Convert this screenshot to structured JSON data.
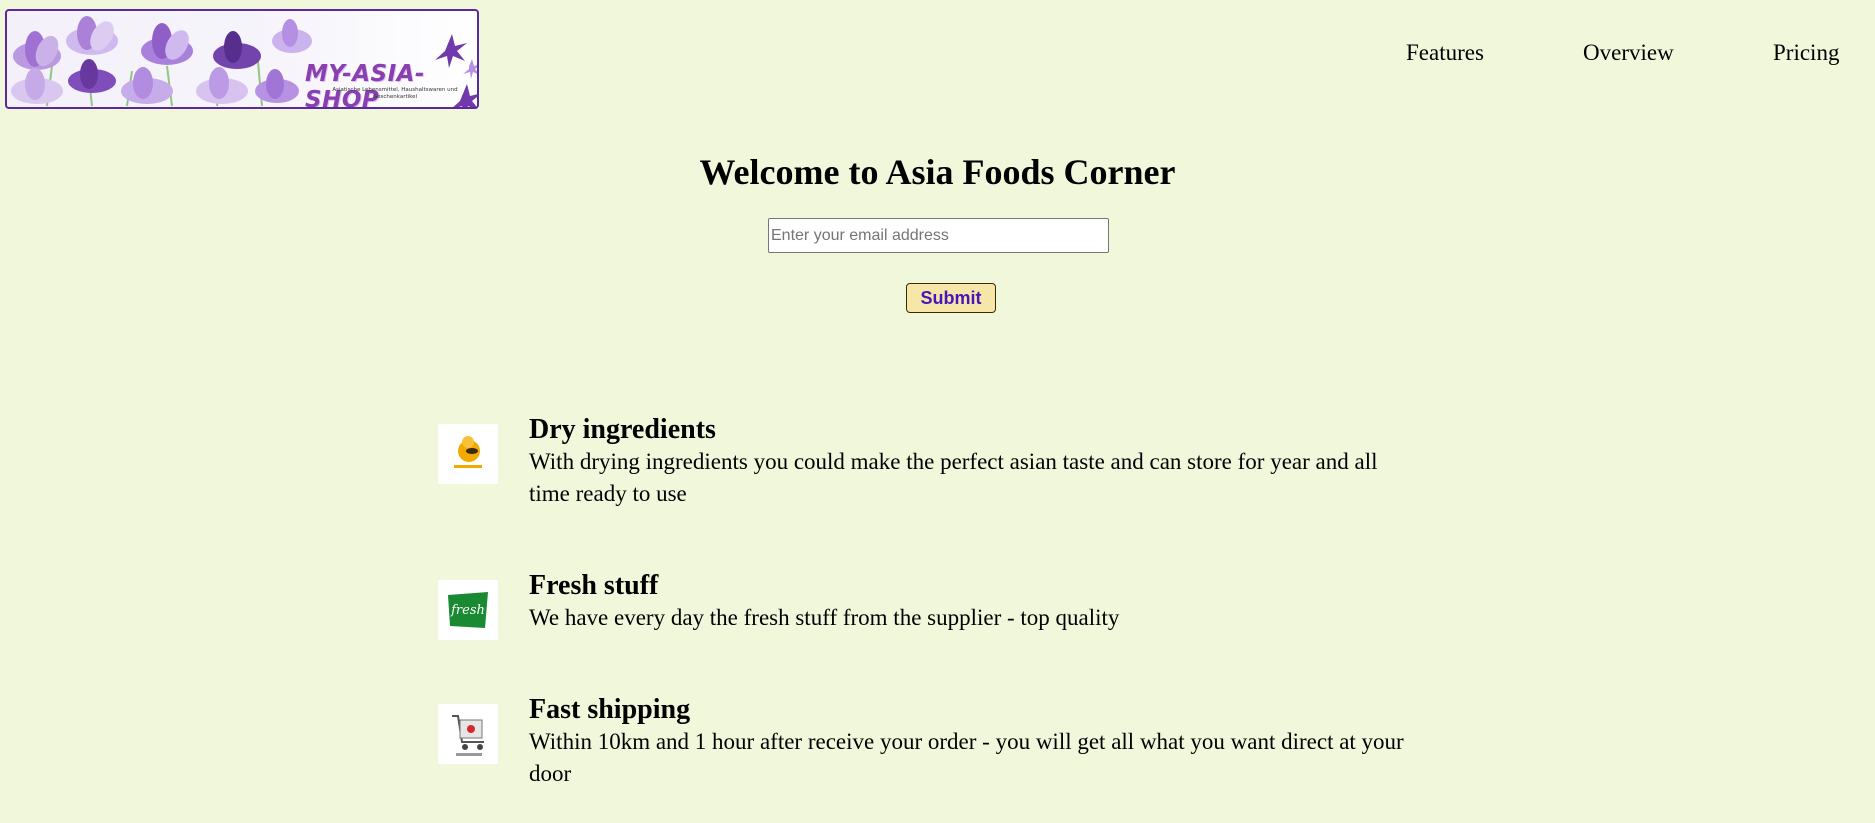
{
  "header": {
    "logo": {
      "title": "MY-ASIA-SHOP",
      "subtitle": "Asiatische Lebensmittel, Haushaltswaren und Geschenkartikel",
      "icon": "lotus-flowers-banner"
    },
    "nav": [
      {
        "label": "Features"
      },
      {
        "label": "Overview"
      },
      {
        "label": "Pricing"
      }
    ]
  },
  "hero": {
    "title": "Welcome to Asia Foods Corner",
    "email_placeholder": "Enter your email address",
    "email_value": "",
    "submit_label": "Submit"
  },
  "features": [
    {
      "icon": "dry-food-icon",
      "title": "Dry ingredients",
      "description": "With drying ingredients you could make the perfect asian taste and can store for year and all time ready to use"
    },
    {
      "icon": "fresh-label-icon",
      "title": "Fresh stuff",
      "description": "We have every day the fresh stuff from the supplier - top quality"
    },
    {
      "icon": "delivery-cart-icon",
      "title": "Fast shipping",
      "description": "Within 10km and 1 hour after receive your order - you will get all what you want direct at your door"
    }
  ],
  "colors": {
    "background": "#f1f7da",
    "logo_border": "#5a2a9a",
    "button_bg": "#f6e7a9",
    "button_text": "#4a14b8"
  }
}
